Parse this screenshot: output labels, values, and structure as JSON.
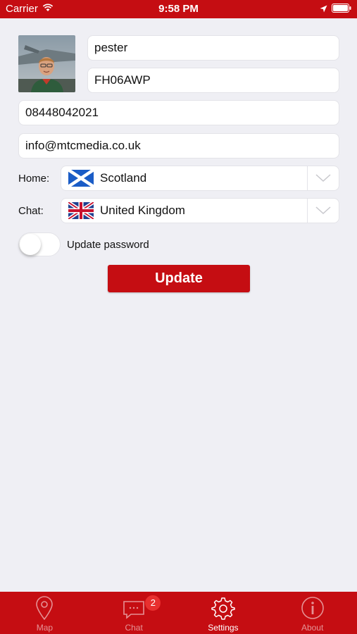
{
  "status_bar": {
    "carrier": "Carrier",
    "time": "9:58 PM"
  },
  "profile": {
    "name": "pester",
    "code": "FH06AWP",
    "phone": "08448042021",
    "email": "info@mtcmedia.co.uk"
  },
  "home": {
    "label": "Home:",
    "value": "Scotland",
    "flag_icon": "scotland-flag-icon"
  },
  "chat_pref": {
    "label": "Chat:",
    "value": "United Kingdom",
    "flag_icon": "uk-flag-icon"
  },
  "password_toggle": {
    "label": "Update password",
    "on": false
  },
  "update_button": {
    "label": "Update"
  },
  "tabs": [
    {
      "label": "Map",
      "icon": "map-pin-icon",
      "active": false
    },
    {
      "label": "Chat",
      "icon": "chat-bubble-icon",
      "active": false,
      "badge": "2"
    },
    {
      "label": "Settings",
      "icon": "gear-icon",
      "active": true
    },
    {
      "label": "About",
      "icon": "info-icon",
      "active": false
    }
  ],
  "colors": {
    "brand_red": "#c50d12",
    "background": "#efeff4",
    "badge_red": "#e8302f"
  }
}
